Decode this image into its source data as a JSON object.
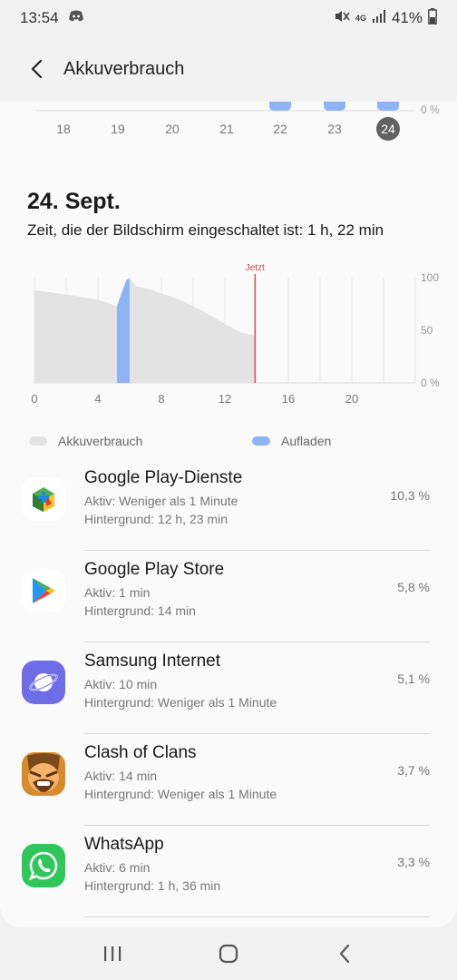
{
  "status_bar": {
    "time": "13:54",
    "network": "4G",
    "battery": "41%"
  },
  "header": {
    "title": "Akkuverbrauch"
  },
  "week": {
    "days": [
      "18",
      "19",
      "20",
      "21",
      "22",
      "23",
      "24"
    ],
    "selected": "24",
    "axis_label": "0 %"
  },
  "day": {
    "title": "24. Sept.",
    "screen_time": "Zeit, die der Bildschirm eingeschaltet ist: 1 h, 22 min"
  },
  "chart_data": {
    "type": "area",
    "x_ticks": [
      "0",
      "4",
      "8",
      "12",
      "16",
      "20"
    ],
    "y_ticks": [
      "100",
      "50",
      "0 %"
    ],
    "now_label": "Jetzt",
    "now_hour": 13.9,
    "xlim": [
      0,
      24
    ],
    "ylim": [
      0,
      100
    ],
    "series": [
      {
        "name": "Akkuverbrauch",
        "x": [
          0,
          2,
          4,
          5.2,
          5.5,
          5.8,
          6.0,
          6.4,
          7,
          8,
          9,
          10,
          11,
          12,
          13,
          13.9
        ],
        "y": [
          88,
          84,
          79,
          73,
          86,
          98,
          99,
          92,
          90,
          85,
          80,
          73,
          65,
          56,
          48,
          45
        ]
      }
    ],
    "charging_intervals": [
      [
        5.2,
        6.0
      ]
    ],
    "legend": [
      {
        "label": "Akkuverbrauch",
        "color": "#e3e3e3"
      },
      {
        "label": "Aufladen",
        "color": "#8fb4f5"
      }
    ]
  },
  "apps": [
    {
      "name": "Google Play-Dienste",
      "active": "Aktiv: Weniger als 1 Minute",
      "background": "Hintergrund: 12 h, 23 min",
      "percent": "10,3 %",
      "icon": "google-play-services-icon"
    },
    {
      "name": "Google Play Store",
      "active": "Aktiv: 1 min",
      "background": "Hintergrund: 14 min",
      "percent": "5,8 %",
      "icon": "google-play-store-icon"
    },
    {
      "name": "Samsung Internet",
      "active": "Aktiv: 10 min",
      "background": "Hintergrund: Weniger als 1 Minute",
      "percent": "5,1 %",
      "icon": "samsung-internet-icon"
    },
    {
      "name": "Clash of Clans",
      "active": "Aktiv: 14 min",
      "background": "Hintergrund: Weniger als 1 Minute",
      "percent": "3,7 %",
      "icon": "clash-of-clans-icon"
    },
    {
      "name": "WhatsApp",
      "active": "Aktiv: 6 min",
      "background": "Hintergrund: 1 h, 36 min",
      "percent": "3,3 %",
      "icon": "whatsapp-icon"
    }
  ]
}
